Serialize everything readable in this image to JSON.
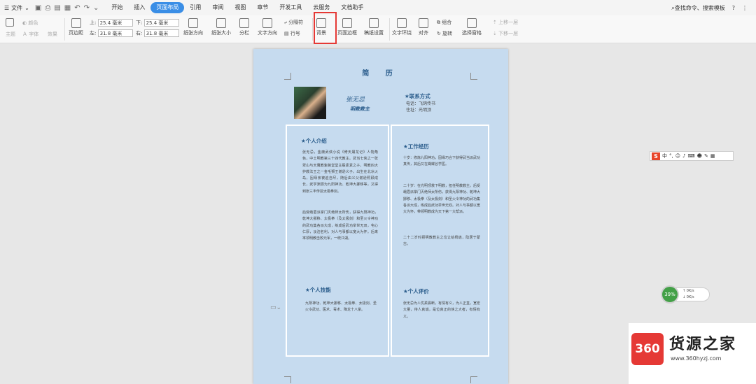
{
  "menubar": {
    "file_label": "文件",
    "tabs": [
      "开始",
      "插入",
      "页面布局",
      "引用",
      "审阅",
      "视图",
      "章节",
      "开发工具",
      "云服务",
      "文档助手"
    ],
    "active_tab": "页面布局",
    "search_text": "查找命令、搜索模板",
    "help": "?"
  },
  "ribbon": {
    "theme": "主题",
    "color": "颜色",
    "font": "字体",
    "effect": "效果",
    "margin": "页边距",
    "top_label": "上:",
    "top_value": "25.4 毫米",
    "bottom_label": "下:",
    "bottom_value": "25.4 毫米",
    "left_label": "左:",
    "left_value": "31.8 毫米",
    "right_label": "右:",
    "right_value": "31.8 毫米",
    "orientation": "纸张方向",
    "size": "纸张大小",
    "columns": "分栏",
    "text_direction": "文字方向",
    "separator": "分隔符",
    "line_number": "行号",
    "background": "背景",
    "page_border": "页面边框",
    "paper_setup": "稿纸设置",
    "text_wrap": "文字环绕",
    "align": "对齐",
    "group": "组合",
    "rotate": "旋转",
    "selection_pane": "选择窗格",
    "move_up": "上移一层",
    "move_down": "下移一层"
  },
  "doc": {
    "title": "简 历",
    "name": "张无忌",
    "role": "明教教主",
    "contact_heading": "★联系方式",
    "phone": "电话：飞鸽传书",
    "address": "住址：光明顶",
    "intro_heading": "★个人介绍",
    "intro_p1": "张无忌，金庸武侠小说《倚天屠龙记》人物角色，中土明教第三十四代教主。武当七侠之一张翠山与天鹰教紫薇堂堂主殷素素之子，明教四大护教法王之一金毛狮王谢逊义子。出生在北冰火岛，因母亲被迫自尽，随后由义父谢逊照顾成长，武学渊源为九阳神功、乾坤大挪移等，又得到张三丰传授太极拳剑。",
    "intro_p2": "后受峨眉派掌门灭绝师太所伤，获得九阳神功，乾坤大挪移、太极拳（及太极剑）和圣火令神功的武功集各派大成，练成后武功举世无双，宅心仁厚，淡泊名利，对人与事都以宽大为怀。后来率领明教击败元军，一统江湖。",
    "work_heading": "★工作经历",
    "work_p1": "十岁：修炼九阳神功，因缘巧合下获得武当派武功真传，其后又在蝴蝶谷学医。",
    "work_p2": "二十岁：在光明顶救下明教，担任明教教主。后受峨眉派掌门灭绝师太所伤，获得九阳神功、乾坤大挪移、太极拳（及太极剑）和圣火令神功的武功集各派大成，练成后武功举世无双。对人与事都以宽大为怀，带领明教成为天下第一大帮派。",
    "work_p3": "二十二岁时把明教教主之位让给杨逍，隐居于蒙古。",
    "skills_heading": "★个人技能",
    "skills_p": "九阳神功、乾坤大挪移、太极拳、太极剑、圣火令武功、医术、毒术、降龙十八掌。",
    "eval_heading": "★个人评价",
    "eval_p": "张无忌为人优柔寡断，有情有义，为人正直，宽宏大量，待人真诚，是位真正的侠之大者，有情有义。"
  },
  "widgets": {
    "ime_mode": "中",
    "speed_percent": "39%",
    "upload": "0K/s",
    "download": "0K/s",
    "watermark_brand": "货源之家",
    "watermark_logo": "360",
    "watermark_url": "www.360hyzj.com"
  }
}
